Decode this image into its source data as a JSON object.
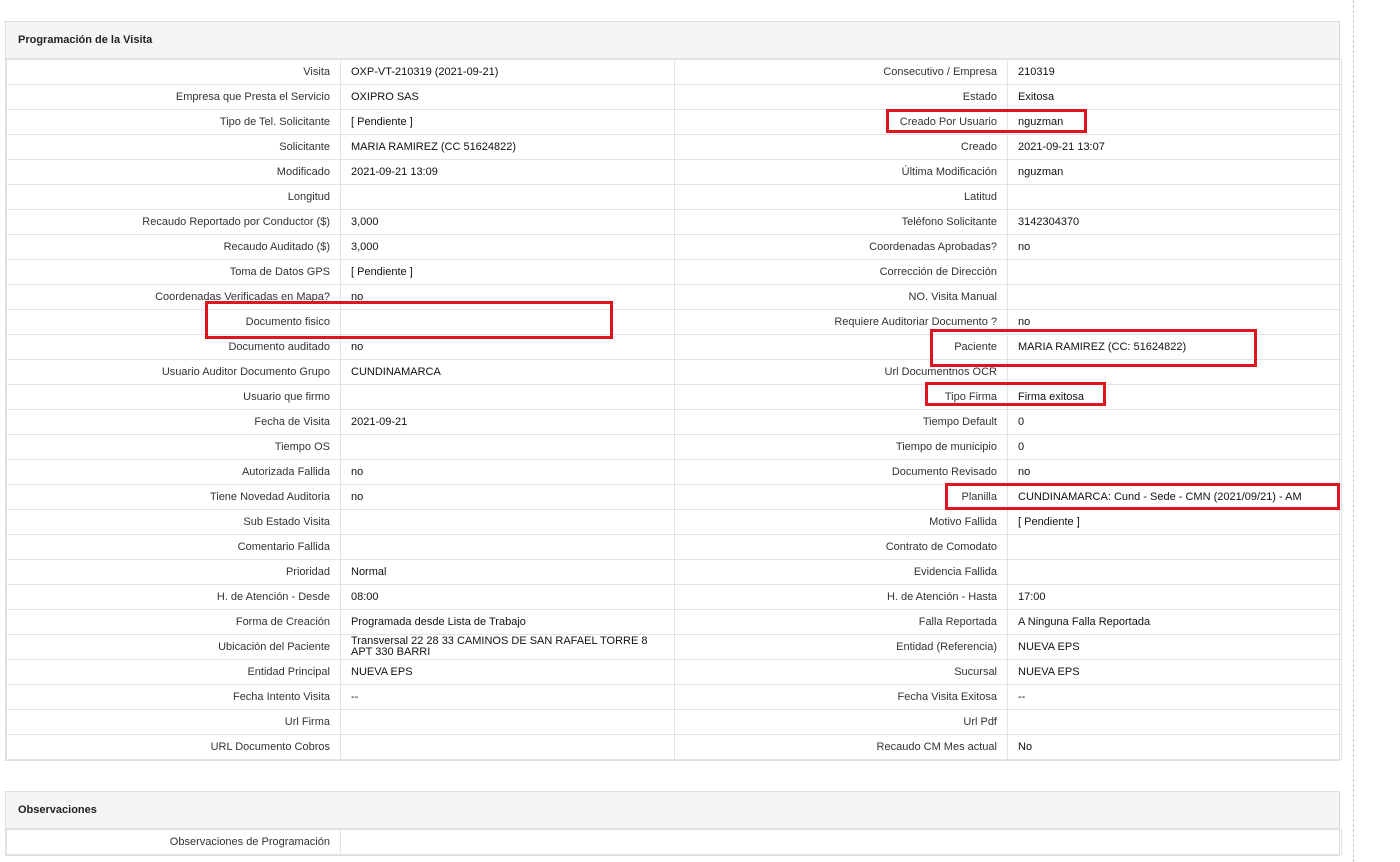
{
  "programacion": {
    "title": "Programación de la Visita",
    "rows": [
      {
        "l1": "Visita",
        "v1": "OXP-VT-210319 (2021-09-21)",
        "l2": "Consecutivo / Empresa",
        "v2": "210319"
      },
      {
        "l1": "Empresa que Presta el Servicio",
        "v1": "OXIPRO SAS",
        "l2": "Estado",
        "v2": "Exitosa"
      },
      {
        "l1": "Tipo de Tel. Solicitante",
        "v1": "[ Pendiente ]",
        "l2": "Creado Por Usuario",
        "v2": "nguzman"
      },
      {
        "l1": "Solicitante",
        "v1": "MARIA RAMIREZ (CC 51624822)",
        "l2": "Creado",
        "v2": "2021-09-21 13:07"
      },
      {
        "l1": "Modificado",
        "v1": "2021-09-21 13:09",
        "l2": "Última Modificación",
        "v2": " nguzman"
      },
      {
        "l1": "Longitud",
        "v1": "",
        "l2": "Latitud",
        "v2": ""
      },
      {
        "l1": "Recaudo Reportado por Conductor ($)",
        "v1": "3,000",
        "l2": "Teléfono Solicitante",
        "v2": "3142304370"
      },
      {
        "l1": "Recaudo Auditado ($)",
        "v1": "3,000",
        "l2": "Coordenadas Aprobadas?",
        "v2": " no"
      },
      {
        "l1": "Toma de Datos GPS",
        "v1": "[ Pendiente ]",
        "l2": "Corrección de Dirección",
        "v2": ""
      },
      {
        "l1": "Coordenadas Verificadas en Mapa?",
        "v1": " no",
        "l2": "NO. Visita Manual",
        "v2": ""
      },
      {
        "l1": "Documento fisico",
        "v1": "",
        "l2": "Requiere Auditoriar Documento ?",
        "v2": " no"
      },
      {
        "l1": "Documento auditado",
        "v1": " no",
        "l2": "Paciente",
        "v2": "MARIA RAMIREZ (CC: 51624822)"
      },
      {
        "l1": "Usuario Auditor Documento Grupo",
        "v1": "CUNDINAMARCA",
        "l2": "Url Documentnos OCR",
        "v2": ""
      },
      {
        "l1": "Usuario que firmo",
        "v1": "",
        "l2": "Tipo Firma",
        "v2": "Firma exitosa"
      },
      {
        "l1": "Fecha de Visita",
        "v1": " 2021-09-21",
        "l2": "Tiempo Default",
        "v2": "0"
      },
      {
        "l1": "Tiempo OS",
        "v1": "",
        "l2": "Tiempo de municipio",
        "v2": "0"
      },
      {
        "l1": "Autorizada Fallida",
        "v1": " no",
        "l2": "Documento Revisado",
        "v2": " no"
      },
      {
        "l1": "Tiene Novedad Auditoria",
        "v1": " no",
        "l2": "Planilla",
        "v2": "CUNDINAMARCA: Cund - Sede - CMN (2021/09/21) - AM"
      },
      {
        "l1": "Sub Estado Visita",
        "v1": "",
        "l2": "Motivo Fallida",
        "v2": "[ Pendiente ]"
      },
      {
        "l1": "Comentario Fallida",
        "v1": "",
        "l2": "Contrato de Comodato",
        "v2": ""
      },
      {
        "l1": "Prioridad",
        "v1": "Normal",
        "l2": "Evidencia Fallida",
        "v2": ""
      },
      {
        "l1": "H. de Atención - Desde",
        "v1": "08:00",
        "l2": "H. de Atención - Hasta",
        "v2": "17:00"
      },
      {
        "l1": "Forma de Creación",
        "v1": "Programada desde Lista de Trabajo",
        "l2": "Falla Reportada",
        "v2": "A Ninguna Falla Reportada"
      },
      {
        "l1": "Ubicación del Paciente",
        "v1": "Transversal 22 28 33 CAMINOS DE SAN RAFAEL TORRE 8 APT 330 BARRI",
        "l2": "Entidad (Referencia)",
        "v2": "NUEVA EPS"
      },
      {
        "l1": "Entidad Principal",
        "v1": "NUEVA EPS",
        "l2": "Sucursal",
        "v2": "NUEVA EPS"
      },
      {
        "l1": "Fecha Intento Visita",
        "v1": " --",
        "l2": "Fecha Visita Exitosa",
        "v2": " --"
      },
      {
        "l1": "Url Firma",
        "v1": "",
        "l2": "Url Pdf",
        "v2": ""
      },
      {
        "l1": "URL Documento Cobros",
        "v1": "",
        "l2": "Recaudo CM Mes actual",
        "v2": "No"
      }
    ]
  },
  "observaciones": {
    "title": "Observaciones",
    "rows": [
      {
        "l1": "Observaciones de Programación",
        "v1": ""
      }
    ]
  },
  "colors": {
    "highlight": "#e0141e",
    "header_bg": "#f5f5f5",
    "border": "#e4e4e4"
  }
}
